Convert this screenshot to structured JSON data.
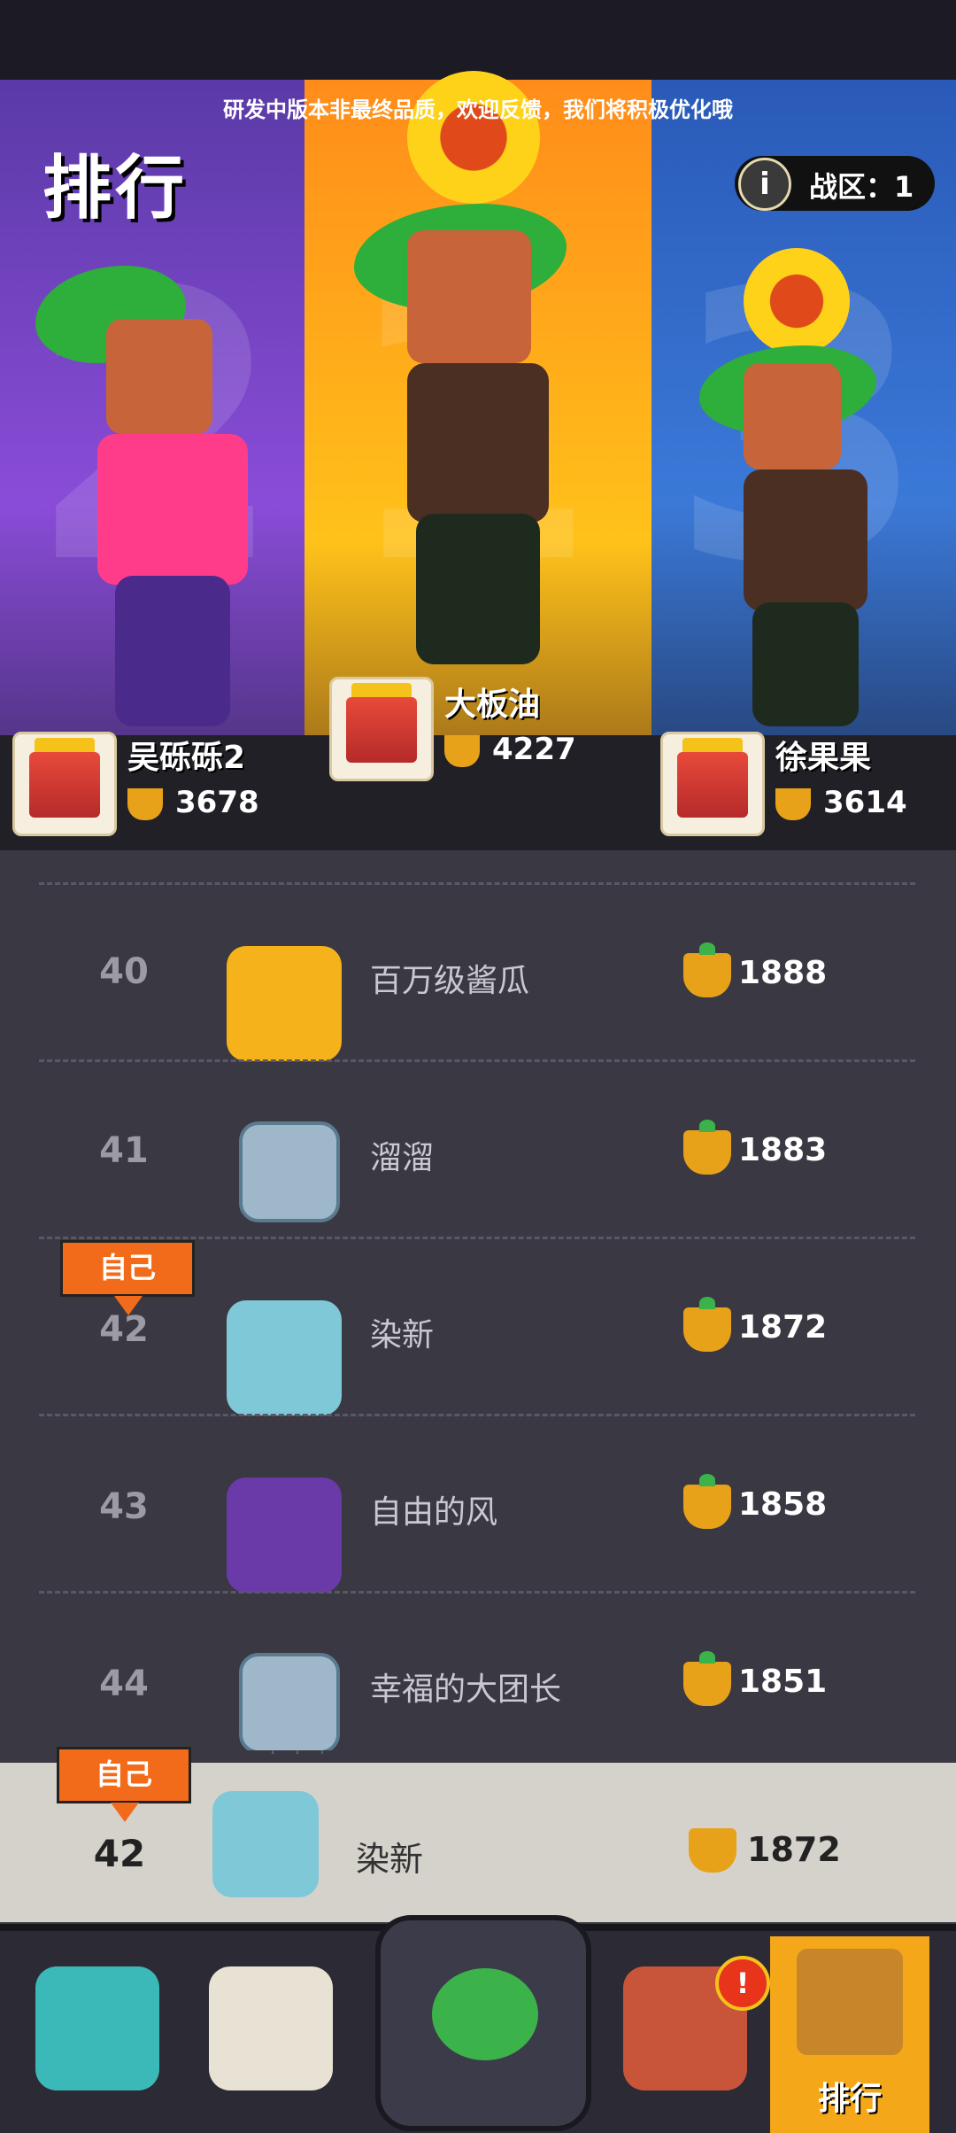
{
  "banner": "研发中版本非最终品质，欢迎反馈，我们将积极优化哦",
  "page_title": "排行",
  "zone": {
    "label": "战区：1"
  },
  "podium": [
    {
      "place": "2",
      "name": "吴砾砾2",
      "score": "3678"
    },
    {
      "place": "1",
      "name": "大板油",
      "score": "4227"
    },
    {
      "place": "3",
      "name": "徐果果",
      "score": "3614"
    }
  ],
  "rows": [
    {
      "rank": "40",
      "name": "百万级酱瓜",
      "score": "1888"
    },
    {
      "rank": "41",
      "name": "溜溜",
      "score": "1883"
    },
    {
      "rank": "42",
      "name": "染新",
      "score": "1872"
    },
    {
      "rank": "43",
      "name": "自由的风",
      "score": "1858"
    },
    {
      "rank": "44",
      "name": "幸福的大团长",
      "score": "1851"
    }
  ],
  "self_tag": "自己",
  "self": {
    "rank": "42",
    "name": "染新",
    "score": "1872"
  },
  "nav": {
    "active_label": "排行"
  }
}
